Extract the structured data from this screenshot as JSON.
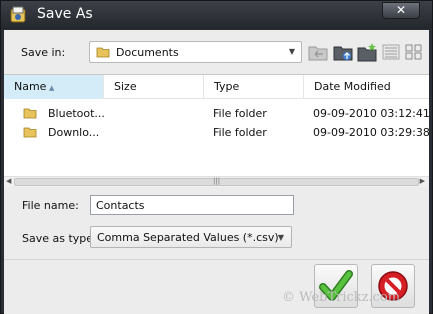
{
  "window": {
    "title": "Save As",
    "close_label": "✕"
  },
  "toolbar": {
    "save_in_label": "Save in:",
    "save_in_value": "Documents",
    "icons": [
      "back-folder-icon",
      "up-folder-icon",
      "new-folder-icon",
      "details-view-icon",
      "list-view-icon"
    ]
  },
  "file_list": {
    "columns": [
      "Name",
      "Size",
      "Type",
      "Date Modified"
    ],
    "rows": [
      {
        "name": "Bluetoot...",
        "size": "",
        "type": "File folder",
        "date": "09-09-2010 03:12:41"
      },
      {
        "name": "Downlo...",
        "size": "",
        "type": "File folder",
        "date": "09-09-2010 03:29:38"
      }
    ]
  },
  "form": {
    "file_name_label": "File name:",
    "file_name_value": "Contacts",
    "save_type_label": "Save as type:",
    "save_type_value": "Comma Separated Values (*.csv)"
  },
  "watermark": "© WebTrickz.com",
  "colors": {
    "title_bar": "#2a2d33",
    "header_sorted": "#d3ecf7",
    "ok_green": "#3aa52e",
    "cancel_red": "#c8181e"
  }
}
